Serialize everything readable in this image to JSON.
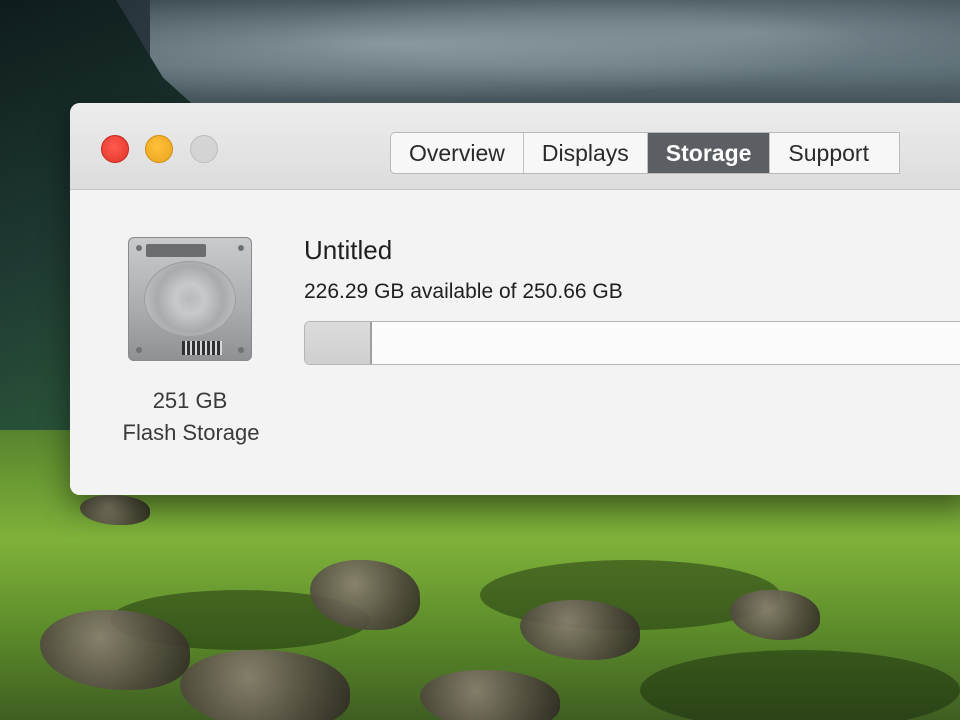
{
  "window": {
    "tabs": [
      {
        "label": "Overview",
        "selected": false
      },
      {
        "label": "Displays",
        "selected": false
      },
      {
        "label": "Storage",
        "selected": true
      },
      {
        "label": "Support",
        "selected": false
      }
    ]
  },
  "storage": {
    "volume_name": "Untitled",
    "capacity_text": "226.29 GB available of 250.66 GB",
    "used_fraction": 0.097,
    "drive_size": "251 GB",
    "drive_type": "Flash Storage"
  },
  "colors": {
    "close_button": "#e0342a",
    "minimize_button": "#e9a21a",
    "selected_tab": "#5b5e63"
  }
}
